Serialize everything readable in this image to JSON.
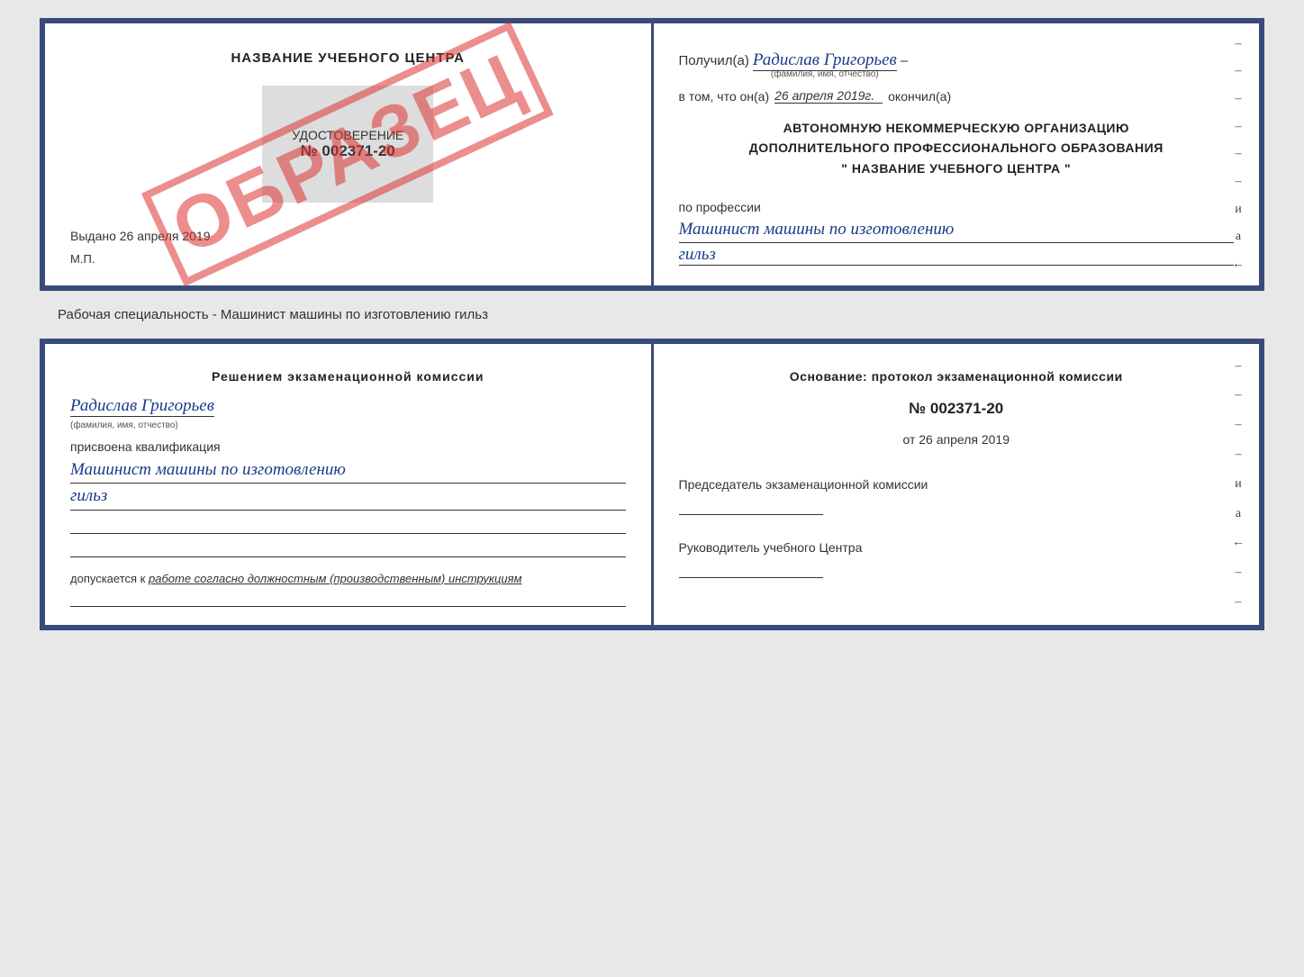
{
  "top_doc": {
    "left": {
      "school_name": "НАЗВАНИЕ УЧЕБНОГО ЦЕНТРА",
      "cert_label": "УДОСТОВЕРЕНИЕ",
      "cert_number": "№ 002371-20",
      "issued_prefix": "Выдано",
      "issued_date": "26 апреля 2019",
      "mp_label": "М.П.",
      "stamp_text": "ОБРАЗЕЦ"
    },
    "right": {
      "poluchil_prefix": "Получил(а)",
      "recipient_name": "Радислав Григорьев",
      "fio_sub": "(фамилия, имя, отчество)",
      "v_tom_prefix": "в том, что он(а)",
      "date_value": "26 апреля 2019г.",
      "okonchil": "окончил(а)",
      "org_line1": "АВТОНОМНУЮ НЕКОММЕРЧЕСКУЮ ОРГАНИЗАЦИЮ",
      "org_line2": "ДОПОЛНИТЕЛЬНОГО ПРОФЕССИОНАЛЬНОГО ОБРАЗОВАНИЯ",
      "org_line3": "\"   НАЗВАНИЕ УЧЕБНОГО ЦЕНТРА   \"",
      "po_professii": "по профессии",
      "profession_line1": "Машинист машины по изготовлению",
      "profession_line2": "гильз"
    }
  },
  "between_label": "Рабочая специальность - Машинист машины по изготовлению гильз",
  "bottom_doc": {
    "left": {
      "header": "Решением  экзаменационной  комиссии",
      "komissia_name": "Радислав Григорьев",
      "name_sub": "(фамилия, имя, отчество)",
      "assigned_label": "присвоена квалификация",
      "qualification_line1": "Машинист машины по изготовлению",
      "qualification_line2": "гильз",
      "допускается_prefix": "допускается к",
      "допускается_value": "работе согласно должностным (производственным) инструкциям"
    },
    "right": {
      "osnovanje_header": "Основание: протокол экзаменационной  комиссии",
      "protocol_number": "№  002371-20",
      "protocol_date_prefix": "от",
      "protocol_date": "26 апреля 2019",
      "chairman_label": "Председатель экзаменационной комиссии",
      "head_label": "Руководитель учебного Центра"
    }
  }
}
